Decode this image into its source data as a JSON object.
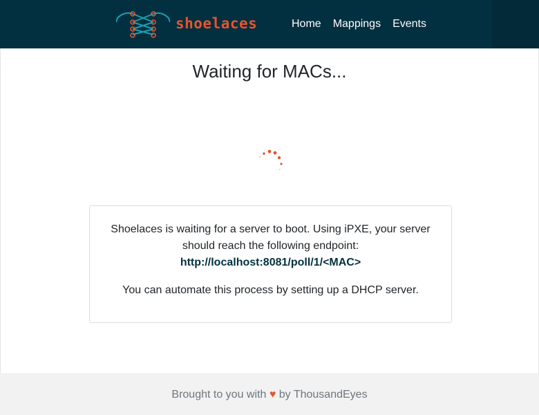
{
  "brand": {
    "name": "shoelaces",
    "accent": "#e8542a",
    "navbar_bg": "#033040"
  },
  "nav": {
    "links": [
      "Home",
      "Mappings",
      "Events"
    ]
  },
  "main": {
    "heading": "Waiting for MACs...",
    "card": {
      "message": "Shoelaces is waiting for a server to boot. Using iPXE, your server should reach the following endpoint:",
      "endpoint": "http://localhost:8081/poll/1/<MAC>",
      "note": "You can automate this process by setting up a DHCP server."
    }
  },
  "footer": {
    "prefix": "Brought to you with",
    "heart": "♥",
    "suffix": "by ThousandEyes"
  },
  "icons": {
    "logo": "shoelaces-logo-icon",
    "spinner": "loading-spinner-icon"
  }
}
